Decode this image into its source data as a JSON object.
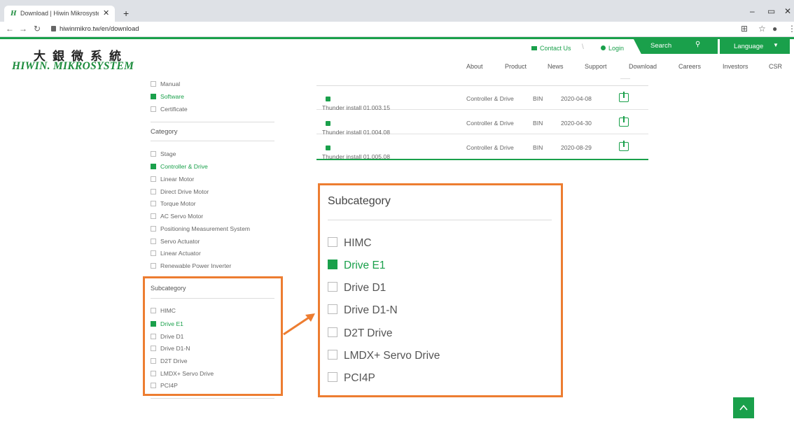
{
  "browser": {
    "tab_title": "Download | Hiwin Mikrosystem",
    "tab_favicon": "H",
    "url": "hiwinmikro.tw/en/download"
  },
  "header": {
    "logo_cn": "大銀微系統",
    "logo_en": "HIWIN. MIKROSYSTEM",
    "contact": "Contact Us",
    "login": "Login",
    "search": "Search",
    "language": "Language",
    "nav": [
      "About",
      "Product",
      "News",
      "Support",
      "Download",
      "Careers",
      "Investors",
      "CSR"
    ]
  },
  "sidebar": {
    "types": [
      {
        "label": "Manual",
        "checked": false
      },
      {
        "label": "Software",
        "checked": true
      },
      {
        "label": "Certificate",
        "checked": false
      }
    ],
    "category_heading": "Category",
    "categories": [
      {
        "label": "Stage",
        "checked": false
      },
      {
        "label": "Controller & Drive",
        "checked": true
      },
      {
        "label": "Linear Motor",
        "checked": false
      },
      {
        "label": "Direct Drive Motor",
        "checked": false
      },
      {
        "label": "Torque Motor",
        "checked": false
      },
      {
        "label": "AC Servo Motor",
        "checked": false
      },
      {
        "label": "Positioning Measurement System",
        "checked": false
      },
      {
        "label": "Servo Actuator",
        "checked": false
      },
      {
        "label": "Linear Actuator",
        "checked": false
      },
      {
        "label": "Renewable Power Inverter",
        "checked": false
      }
    ],
    "subcategory_heading": "Subcategory",
    "subcategories": [
      {
        "label": "HIMC",
        "checked": false
      },
      {
        "label": "Drive E1",
        "checked": true
      },
      {
        "label": "Drive D1",
        "checked": false
      },
      {
        "label": "Drive D1-N",
        "checked": false
      },
      {
        "label": "D2T Drive",
        "checked": false
      },
      {
        "label": "LMDX+ Servo Drive",
        "checked": false
      },
      {
        "label": "PCI4P",
        "checked": false
      }
    ]
  },
  "downloads": [
    {
      "name": "Thunder install 01.003.15",
      "category": "Controller & Drive",
      "format": "BIN",
      "date": "2020-04-08"
    },
    {
      "name": "Thunder install 01.004.08",
      "category": "Controller & Drive",
      "format": "BIN",
      "date": "2020-04-30"
    },
    {
      "name": "Thunder install 01.005.08",
      "category": "Controller & Drive",
      "format": "BIN",
      "date": "2020-08-29"
    }
  ],
  "callout": {
    "heading": "Subcategory",
    "items": [
      {
        "label": "HIMC",
        "checked": false
      },
      {
        "label": "Drive E1",
        "checked": true
      },
      {
        "label": "Drive D1",
        "checked": false
      },
      {
        "label": "Drive D1-N",
        "checked": false
      },
      {
        "label": "D2T Drive",
        "checked": false
      },
      {
        "label": "LMDX+ Servo Drive",
        "checked": false
      },
      {
        "label": "PCI4P",
        "checked": false
      }
    ]
  },
  "colors": {
    "brand_green": "#1aa04b",
    "highlight_orange": "#ed7d31"
  },
  "icons": [
    "back-arrow-icon",
    "forward-arrow-icon",
    "reload-icon",
    "lock-icon",
    "star-icon",
    "account-icon",
    "search-icon",
    "download-icon",
    "arrow-up-icon"
  ]
}
